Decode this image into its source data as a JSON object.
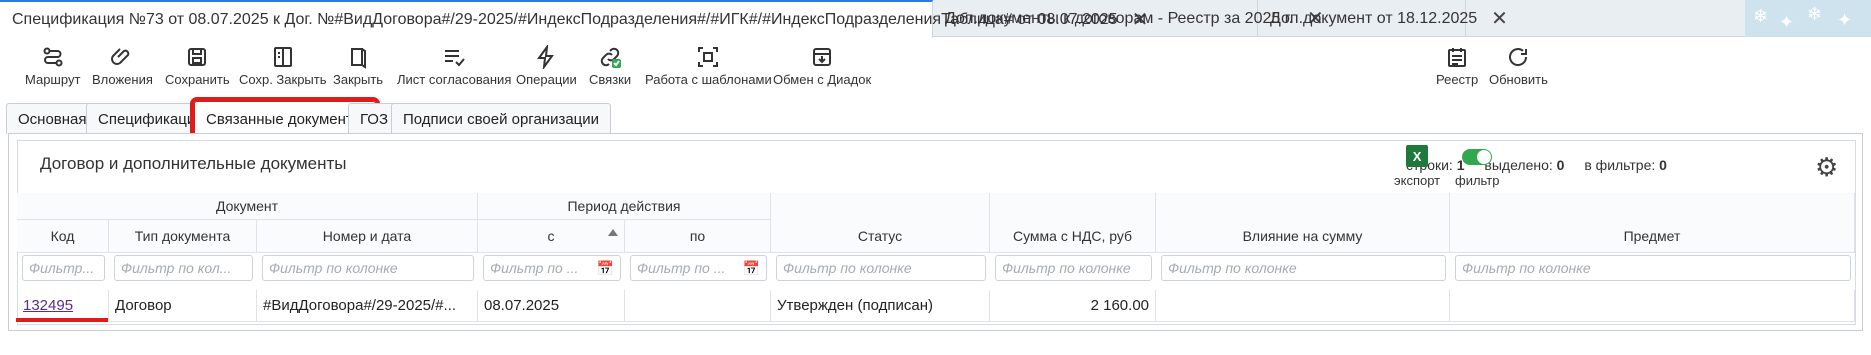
{
  "doc_tabs": [
    {
      "label": "Спецификация №73 от 08.07.2025 к Дог. №#ВидДоговора#/29-2025/#ИндексПодразделения#/#ИГК#/#ИндексПодразделенияТаблица# от 08.07.2025",
      "close": "✕"
    },
    {
      "label": "Доп.документы к договорам - Реестр за 2025 г.",
      "close": "✕"
    },
    {
      "label": "Доп.документ от 18.12.2025",
      "close": "✕"
    }
  ],
  "toolbar": {
    "route": "Маршрут",
    "attachments": "Вложения",
    "save": "Сохранить",
    "save_close": "Сохр. Закрыть",
    "close": "Закрыть",
    "approval_sheet": "Лист согласования",
    "operations": "Операции",
    "links": "Связки",
    "templates": "Работа с шаблонами",
    "diadoc": "Обмен с Диадок",
    "registry": "Реестр",
    "refresh": "Обновить"
  },
  "section_tabs": [
    "Основная",
    "Спецификация",
    "Связанные документы",
    "ГОЗ",
    "Подписи своей организации"
  ],
  "panel": {
    "title": "Договор и дополнительные документы",
    "rows_label": "строки:",
    "rows_value": "1",
    "selected_label": "выделено:",
    "selected_value": "0",
    "filtered_label": "в фильтре:",
    "filtered_value": "0",
    "export_label": "экспорт",
    "export_icon_text": "X",
    "filter_label": "фильтр"
  },
  "table": {
    "group_document": "Документ",
    "group_period": "Период действия",
    "columns": {
      "code": "Код",
      "doc_type": "Тип документа",
      "number_date": "Номер и дата",
      "from": "с",
      "to": "по",
      "status": "Статус",
      "amount": "Сумма с НДС, руб",
      "influence": "Влияние на сумму",
      "subject": "Предмет"
    },
    "filters": {
      "code": "Фильтр...",
      "doc_type": "Фильтр по кол...",
      "number_date": "Фильтр по колонке",
      "from": "Фильтр по ...",
      "to": "Фильтр по ...",
      "status": "Фильтр по колонке",
      "amount": "Фильтр по колонке",
      "influence": "Фильтр по колонке",
      "subject": "Фильтр по колонке"
    },
    "rows": [
      {
        "code": "132495",
        "doc_type": "Договор",
        "number_date": "#ВидДоговора#/29-2025/#...",
        "from": "08.07.2025",
        "to": "",
        "status": "Утвержден (подписан)",
        "amount": "2 160.00",
        "influence": "",
        "subject": ""
      }
    ]
  },
  "colors": {
    "accent": "#2c7be5",
    "highlight": "#e01b1b",
    "excel": "#1d7a3a",
    "toggle": "#31a84f",
    "link": "#5a2d91"
  }
}
